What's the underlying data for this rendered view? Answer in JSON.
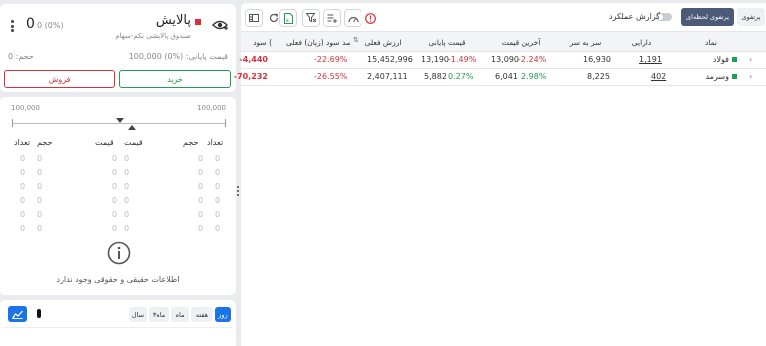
{
  "colors": {
    "accent": "#1a73e8",
    "buy": "#1f9d55",
    "sell": "#d9303a",
    "brand_square": "#d9303a"
  },
  "left": {
    "symbol": "پالایش",
    "subtitle": "صندوق پالایشی یکم-سهام",
    "price_value": "0",
    "price_change": "0 (0%)",
    "base_price_label": "قیمت پایانی:",
    "base_price_value": "100,000 (0%)",
    "volume_label": "حجم:",
    "volume_value": "0",
    "buy_label": "خرید",
    "sell_label": "فروش",
    "range_low": "100,000",
    "range_high": "100,000",
    "ob_headers": {
      "count": "تعداد",
      "volume": "حجم",
      "price": "قیمت"
    },
    "ob_zero": "0",
    "empty_message": "اطلاعات حقیقی و حقوقی وجود ندارد",
    "periods": [
      "روز",
      "هفته",
      "ماه",
      "۳ماه",
      "سال"
    ]
  },
  "toolbar": {
    "tab_portfolio": "پرتفوی",
    "tab_instant": "پرتفوی لحظه‌ای",
    "report_label": "گزارش عملکرد"
  },
  "table": {
    "headers": [
      "نماد",
      "دارایی",
      "سر به سر",
      "آخرین قیمت",
      "قیمت پایانی",
      "ارزش فعلی",
      "درصد سود (زیان) فعلی",
      "سود ("
    ],
    "rows": [
      {
        "symbol": "فولاد",
        "assets": "1,191",
        "breakeven": "16,930",
        "last_price": "13,090",
        "last_change": "-2.24%",
        "close_price": "13,190",
        "close_change": "-1.49%",
        "value": "15,452,996",
        "pct": "-22.69%",
        "profit": "-4,440"
      },
      {
        "symbol": "وسرمد",
        "assets": "402",
        "breakeven": "8,225",
        "last_price": "6,041",
        "last_change": "2.98%",
        "close_price": "5,882",
        "close_change": "0.27%",
        "value": "2,407,111",
        "pct": "-26.55%",
        "profit": "-70,232"
      }
    ]
  }
}
